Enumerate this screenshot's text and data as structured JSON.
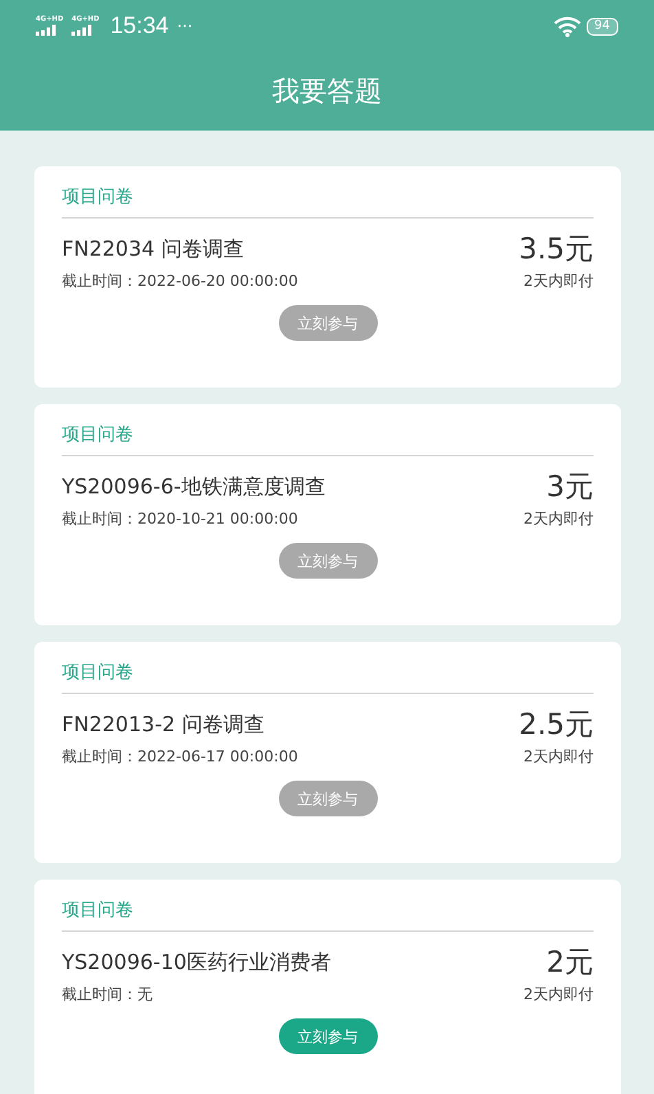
{
  "status_bar": {
    "networks": [
      "4G+HD",
      "4G+HD"
    ],
    "time": "15:34",
    "more": "···",
    "battery": "94"
  },
  "header": {
    "title": "我要答题"
  },
  "surveys": [
    {
      "category": "项目问卷",
      "title": "FN22034 问卷调查",
      "deadline": "截止时间：2022-06-20 00:00:00",
      "reward": "3.5元",
      "payment": "2天内即付",
      "button": "立刻参与",
      "disabled": true
    },
    {
      "category": "项目问卷",
      "title": "YS20096-6-地铁满意度调查",
      "deadline": "截止时间：2020-10-21 00:00:00",
      "reward": "3元",
      "payment": "2天内即付",
      "button": "立刻参与",
      "disabled": true
    },
    {
      "category": "项目问卷",
      "title": "FN22013-2 问卷调查",
      "deadline": "截止时间：2022-06-17 00:00:00",
      "reward": "2.5元",
      "payment": "2天内即付",
      "button": "立刻参与",
      "disabled": true
    },
    {
      "category": "项目问卷",
      "title": "YS20096-10医药行业消费者",
      "deadline": "截止时间：无",
      "reward": "2元",
      "payment": "2天内即付",
      "button": "立刻参与",
      "disabled": false
    }
  ]
}
